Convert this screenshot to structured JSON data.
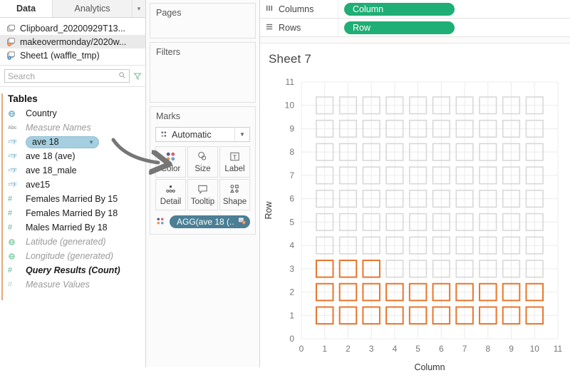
{
  "left_pane": {
    "tabs": [
      {
        "label": "Data",
        "active": true
      },
      {
        "label": "Analytics",
        "active": false
      }
    ],
    "tab_caret_icon": "sort-caret-icon",
    "datasources": [
      {
        "label": "Clipboard_20200929T13...",
        "icon": "datasource-icon",
        "selected": false
      },
      {
        "label": "makeovermonday/2020w...",
        "icon": "datasource-live-icon",
        "selected": true
      },
      {
        "label": "Sheet1 (waffle_tmp)",
        "icon": "datasource-live-icon",
        "selected": false
      }
    ],
    "search": {
      "placeholder": "Search",
      "value": "",
      "search_icon": "search-icon",
      "filter_icon": "funnel-icon",
      "view_icon": "columns-view-icon",
      "view_caret_icon": "chevron-down-icon"
    },
    "tables_header": "Tables",
    "fields": [
      {
        "label": "Country",
        "icon": "globe-icon",
        "style": "dim",
        "selected": false
      },
      {
        "label": "Measure Names",
        "icon": "abc-icon",
        "style": "grey-italic",
        "selected": false
      },
      {
        "label": "ave 18",
        "icon": "calc-string-icon",
        "style": "dim",
        "selected": true
      },
      {
        "label": "ave 18 (ave)",
        "icon": "calc-string-icon",
        "style": "dim",
        "selected": false
      },
      {
        "label": "ave 18_male",
        "icon": "calc-string-icon",
        "style": "dim",
        "selected": false
      },
      {
        "label": "ave15",
        "icon": "calc-string-icon",
        "style": "dim",
        "selected": false
      },
      {
        "label": "Females Married By 15",
        "icon": "measure-icon",
        "style": "dim",
        "selected": false
      },
      {
        "label": "Females Married By 18",
        "icon": "measure-icon",
        "style": "dim",
        "selected": false
      },
      {
        "label": "Males Married By 18",
        "icon": "measure-icon",
        "style": "dim",
        "selected": false
      },
      {
        "label": "Latitude (generated)",
        "icon": "geo-gen-icon",
        "style": "grey-italic",
        "selected": false
      },
      {
        "label": "Longitude (generated)",
        "icon": "geo-gen-icon",
        "style": "grey-italic",
        "selected": false
      },
      {
        "label": "Query Results (Count)",
        "icon": "measure-icon",
        "style": "bold-italic",
        "selected": false
      },
      {
        "label": "Measure Values",
        "icon": "measure-pale-icon",
        "style": "grey-italic",
        "selected": false
      }
    ],
    "selected_field_caret_icon": "chevron-down-icon"
  },
  "card_pane": {
    "pages": {
      "title": "Pages"
    },
    "filters": {
      "title": "Filters"
    },
    "marks": {
      "title": "Marks",
      "mark_type": "Automatic",
      "mark_type_icon": "automatic-marks-icon",
      "mark_type_caret_icon": "chevron-down-icon",
      "buttons": [
        {
          "label": "Color",
          "icon": "color-dots-icon"
        },
        {
          "label": "Size",
          "icon": "size-circles-icon"
        },
        {
          "label": "Label",
          "icon": "label-t-icon"
        },
        {
          "label": "Detail",
          "icon": "detail-dots-icon"
        },
        {
          "label": "Tooltip",
          "icon": "tooltip-bubble-icon"
        },
        {
          "label": "Shape",
          "icon": "shape-glyphs-icon"
        }
      ],
      "color_pill": {
        "label": "AGG(ave 18 (..",
        "slot_icon": "color-dots-icon",
        "trailing_icon": "calculated-field-icon",
        "color": "#4a7f95"
      }
    }
  },
  "shelves": {
    "columns": {
      "label": "Columns",
      "icon": "columns-shelf-icon",
      "pill": "Column",
      "pill_color": "#1fae75"
    },
    "rows": {
      "label": "Rows",
      "icon": "rows-shelf-icon",
      "pill": "Row",
      "pill_color": "#1fae75"
    }
  },
  "view": {
    "sheet_title": "Sheet 7"
  },
  "annotation": {
    "arrow_name": "curved-arrow-annotation",
    "color": "#767676"
  },
  "chart_data": {
    "type": "heatmap",
    "title": "Sheet 7",
    "xlabel": "Column",
    "ylabel": "Row",
    "xlim": [
      0,
      11
    ],
    "ylim": [
      0,
      11
    ],
    "xticks": [
      0,
      1,
      2,
      3,
      4,
      5,
      6,
      7,
      8,
      9,
      10,
      11
    ],
    "yticks": [
      0,
      1,
      2,
      3,
      4,
      5,
      6,
      7,
      8,
      9,
      10,
      11
    ],
    "grid": true,
    "legend": "none",
    "mark_shape": "hollow-square",
    "colors": {
      "highlighted": "#e8762d",
      "empty": "#d8d8d8"
    },
    "cell_columns": [
      1,
      2,
      3,
      4,
      5,
      6,
      7,
      8,
      9,
      10
    ],
    "cell_rows": [
      1,
      2,
      3,
      4,
      5,
      6,
      7,
      8,
      9,
      10
    ],
    "highlighted_count": 23,
    "total_cells": 100,
    "highlighted_cells": [
      {
        "row": 1,
        "columns": [
          1,
          2,
          3,
          4,
          5,
          6,
          7,
          8,
          9,
          10
        ]
      },
      {
        "row": 2,
        "columns": [
          1,
          2,
          3,
          4,
          5,
          6,
          7,
          8,
          9,
          10
        ]
      },
      {
        "row": 3,
        "columns": [
          1,
          2,
          3
        ]
      }
    ]
  }
}
